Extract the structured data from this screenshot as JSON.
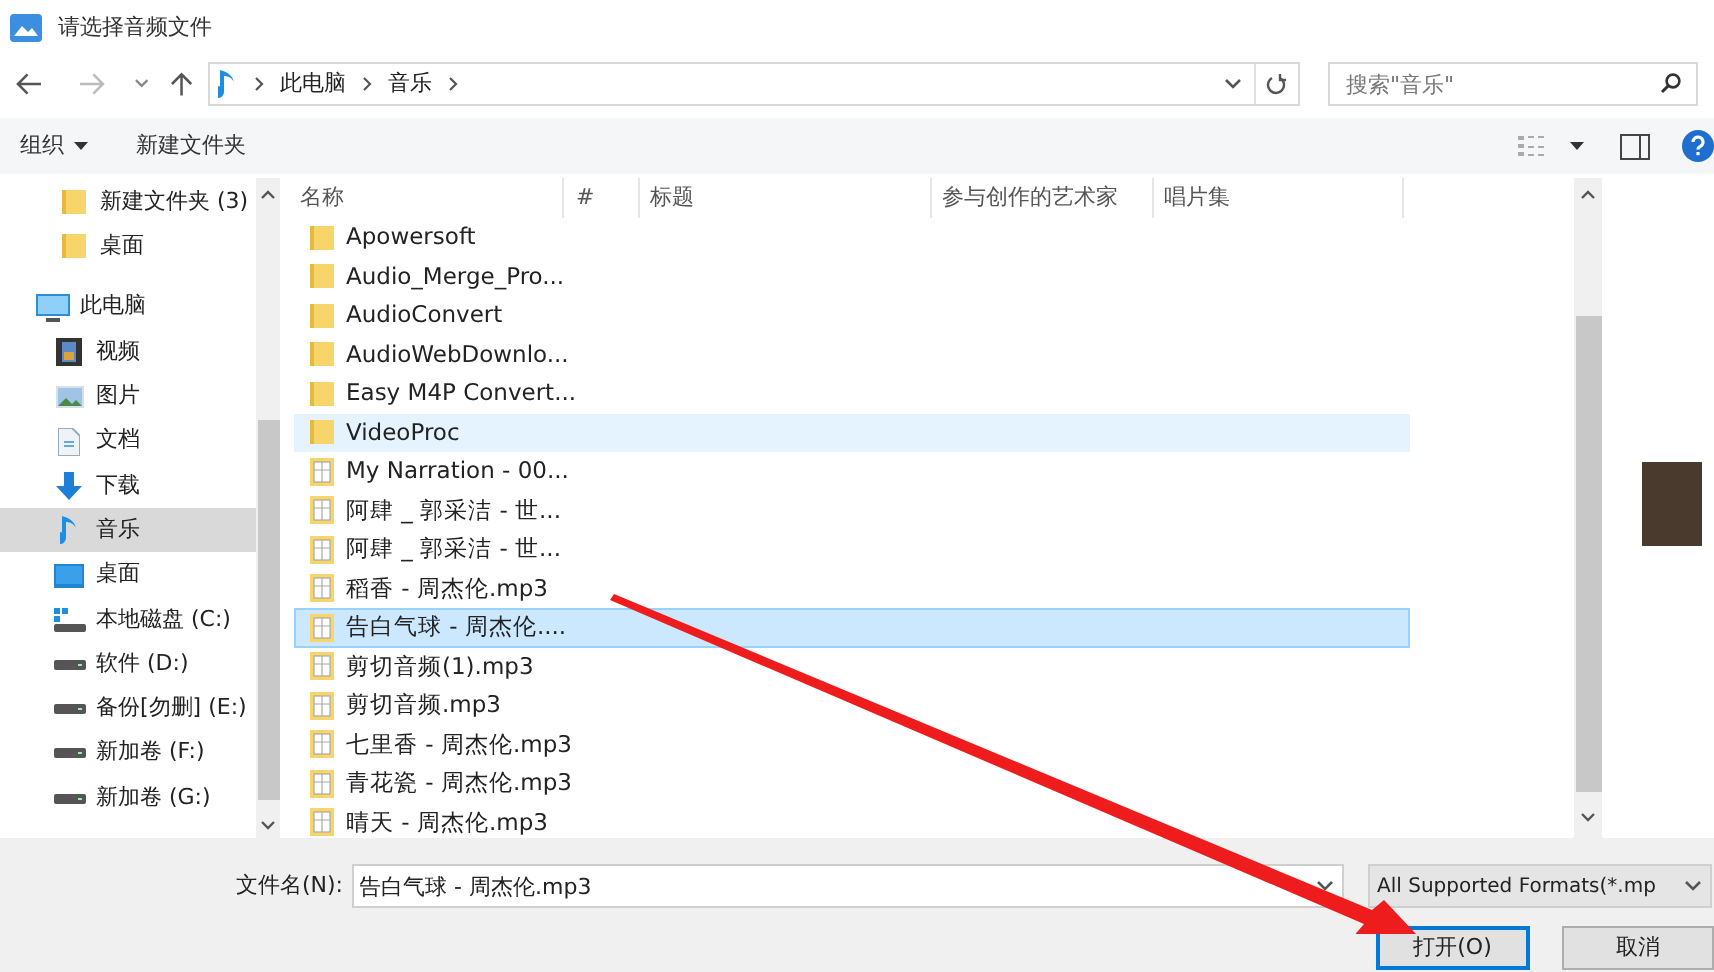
{
  "window": {
    "title": "请选择音频文件"
  },
  "address_bar": {
    "path": [
      "此电脑",
      "音乐"
    ]
  },
  "search": {
    "placeholder": "搜索\"音乐\""
  },
  "toolbar": {
    "buttons": [
      "组织",
      "新建文件夹"
    ]
  },
  "sidebar": {
    "items": [
      {
        "label": "新建文件夹 (3)",
        "kind": "folder",
        "selected": false
      },
      {
        "label": "桌面",
        "kind": "folder",
        "selected": false
      },
      {
        "label": "此电脑",
        "kind": "pc",
        "selected": false
      },
      {
        "label": "视频",
        "kind": "video",
        "selected": false
      },
      {
        "label": "图片",
        "kind": "picture",
        "selected": false
      },
      {
        "label": "文档",
        "kind": "document",
        "selected": false
      },
      {
        "label": "下载",
        "kind": "download",
        "selected": false
      },
      {
        "label": "音乐",
        "kind": "music",
        "selected": true
      },
      {
        "label": "桌面",
        "kind": "desktop",
        "selected": false
      },
      {
        "label": "本地磁盘 (C:)",
        "kind": "sysdrive",
        "selected": false
      },
      {
        "label": "软件 (D:)",
        "kind": "drive",
        "selected": false
      },
      {
        "label": "备份[勿删] (E:)",
        "kind": "drive",
        "selected": false
      },
      {
        "label": "新加卷 (F:)",
        "kind": "drive",
        "selected": false
      },
      {
        "label": "新加卷 (G:)",
        "kind": "drive",
        "selected": false
      }
    ]
  },
  "table": {
    "columns": [
      "名称",
      "#",
      "标题",
      "参与创作的艺术家",
      "唱片集"
    ],
    "rows": [
      {
        "name": "Apowersoft",
        "kind": "folder",
        "selected": false,
        "hovered": false
      },
      {
        "name": "Audio_Merge_Pro...",
        "kind": "folder",
        "selected": false,
        "hovered": false
      },
      {
        "name": "AudioConvert",
        "kind": "folder",
        "selected": false,
        "hovered": false
      },
      {
        "name": "AudioWebDownlo...",
        "kind": "folder",
        "selected": false,
        "hovered": false
      },
      {
        "name": "Easy M4P Convert...",
        "kind": "folder",
        "selected": false,
        "hovered": false
      },
      {
        "name": "VideoProc",
        "kind": "folder",
        "selected": false,
        "hovered": true
      },
      {
        "name": "My Narration - 00...",
        "kind": "audio",
        "selected": false,
        "hovered": false
      },
      {
        "name": "阿肆 _ 郭采洁 - 世...",
        "kind": "audio",
        "selected": false,
        "hovered": false
      },
      {
        "name": "阿肆 _ 郭采洁 - 世...",
        "kind": "audio",
        "selected": false,
        "hovered": false
      },
      {
        "name": "稻香 - 周杰伦.mp3",
        "kind": "audio",
        "selected": false,
        "hovered": false
      },
      {
        "name": "告白气球 - 周杰伦....",
        "kind": "audio",
        "selected": true,
        "hovered": false
      },
      {
        "name": "剪切音频(1).mp3",
        "kind": "audio",
        "selected": false,
        "hovered": false
      },
      {
        "name": "剪切音频.mp3",
        "kind": "audio",
        "selected": false,
        "hovered": false
      },
      {
        "name": "七里香 - 周杰伦.mp3",
        "kind": "audio",
        "selected": false,
        "hovered": false
      },
      {
        "name": "青花瓷 - 周杰伦.mp3",
        "kind": "audio",
        "selected": false,
        "hovered": false
      },
      {
        "name": "晴天 - 周杰伦.mp3",
        "kind": "audio",
        "selected": false,
        "hovered": false
      }
    ]
  },
  "footer": {
    "filename_label": "文件名(N):",
    "filename_value": "告白气球 - 周杰伦.mp3",
    "filter": "All Supported Formats(*.mp",
    "buttons": [
      {
        "label": "打开(O)",
        "kind": "primary"
      },
      {
        "label": "取消",
        "kind": "normal"
      }
    ]
  }
}
